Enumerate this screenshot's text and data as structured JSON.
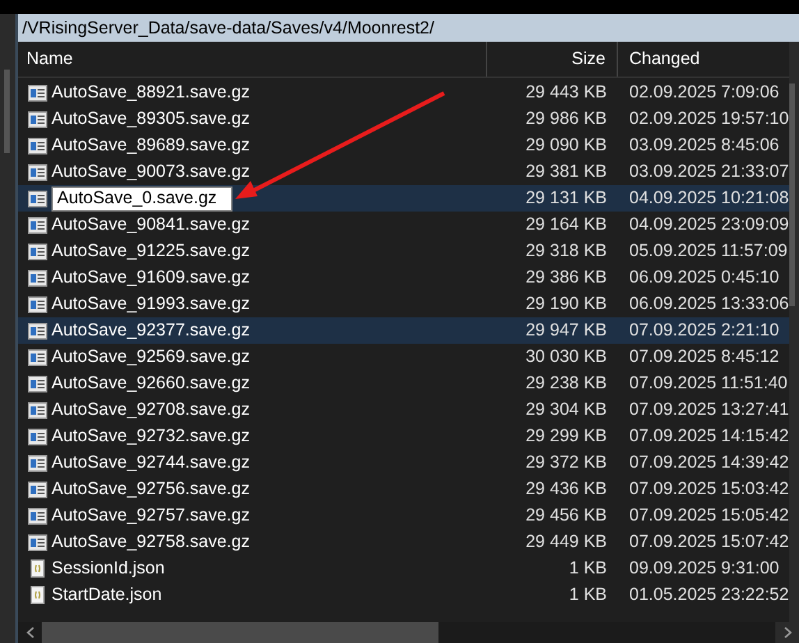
{
  "path_bar": {
    "path": "/VRisingServer_Data/save-data/Saves/v4/Moonrest2/"
  },
  "table": {
    "columns": [
      "Name",
      "Size",
      "Changed"
    ],
    "rows": [
      {
        "kind": "save",
        "name": "AutoSave_88921.save.gz",
        "size": "29 443 KB",
        "changed": "02.09.2025 7:09:06",
        "selected": false,
        "editing": false
      },
      {
        "kind": "save",
        "name": "AutoSave_89305.save.gz",
        "size": "29 986 KB",
        "changed": "02.09.2025 19:57:10",
        "selected": false,
        "editing": false
      },
      {
        "kind": "save",
        "name": "AutoSave_89689.save.gz",
        "size": "29 090 KB",
        "changed": "03.09.2025 8:45:06",
        "selected": false,
        "editing": false
      },
      {
        "kind": "save",
        "name": "AutoSave_90073.save.gz",
        "size": "29 381 KB",
        "changed": "03.09.2025 21:33:07",
        "selected": false,
        "editing": false
      },
      {
        "kind": "save",
        "name": "AutoSave_0.save.gz",
        "size": "29 131 KB",
        "changed": "04.09.2025 10:21:08",
        "selected": true,
        "editing": true
      },
      {
        "kind": "save",
        "name": "AutoSave_90841.save.gz",
        "size": "29 164 KB",
        "changed": "04.09.2025 23:09:09",
        "selected": false,
        "editing": false
      },
      {
        "kind": "save",
        "name": "AutoSave_91225.save.gz",
        "size": "29 318 KB",
        "changed": "05.09.2025 11:57:09",
        "selected": false,
        "editing": false
      },
      {
        "kind": "save",
        "name": "AutoSave_91609.save.gz",
        "size": "29 386 KB",
        "changed": "06.09.2025 0:45:10",
        "selected": false,
        "editing": false
      },
      {
        "kind": "save",
        "name": "AutoSave_91993.save.gz",
        "size": "29 190 KB",
        "changed": "06.09.2025 13:33:06",
        "selected": false,
        "editing": false
      },
      {
        "kind": "save",
        "name": "AutoSave_92377.save.gz",
        "size": "29 947 KB",
        "changed": "07.09.2025 2:21:10",
        "selected": true,
        "editing": false
      },
      {
        "kind": "save",
        "name": "AutoSave_92569.save.gz",
        "size": "30 030 KB",
        "changed": "07.09.2025 8:45:12",
        "selected": false,
        "editing": false
      },
      {
        "kind": "save",
        "name": "AutoSave_92660.save.gz",
        "size": "29 238 KB",
        "changed": "07.09.2025 11:51:40",
        "selected": false,
        "editing": false
      },
      {
        "kind": "save",
        "name": "AutoSave_92708.save.gz",
        "size": "29 304 KB",
        "changed": "07.09.2025 13:27:41",
        "selected": false,
        "editing": false
      },
      {
        "kind": "save",
        "name": "AutoSave_92732.save.gz",
        "size": "29 299 KB",
        "changed": "07.09.2025 14:15:42",
        "selected": false,
        "editing": false
      },
      {
        "kind": "save",
        "name": "AutoSave_92744.save.gz",
        "size": "29 372 KB",
        "changed": "07.09.2025 14:39:42",
        "selected": false,
        "editing": false
      },
      {
        "kind": "save",
        "name": "AutoSave_92756.save.gz",
        "size": "29 436 KB",
        "changed": "07.09.2025 15:03:42",
        "selected": false,
        "editing": false
      },
      {
        "kind": "save",
        "name": "AutoSave_92757.save.gz",
        "size": "29 456 KB",
        "changed": "07.09.2025 15:05:42",
        "selected": false,
        "editing": false
      },
      {
        "kind": "save",
        "name": "AutoSave_92758.save.gz",
        "size": "29 449 KB",
        "changed": "07.09.2025 15:07:42",
        "selected": false,
        "editing": false
      },
      {
        "kind": "json",
        "name": "SessionId.json",
        "size": "1 KB",
        "changed": "09.09.2025 9:31:00",
        "selected": false,
        "editing": false
      },
      {
        "kind": "json",
        "name": "StartDate.json",
        "size": "1 KB",
        "changed": "01.05.2025 23:22:52",
        "selected": false,
        "editing": false
      }
    ]
  }
}
